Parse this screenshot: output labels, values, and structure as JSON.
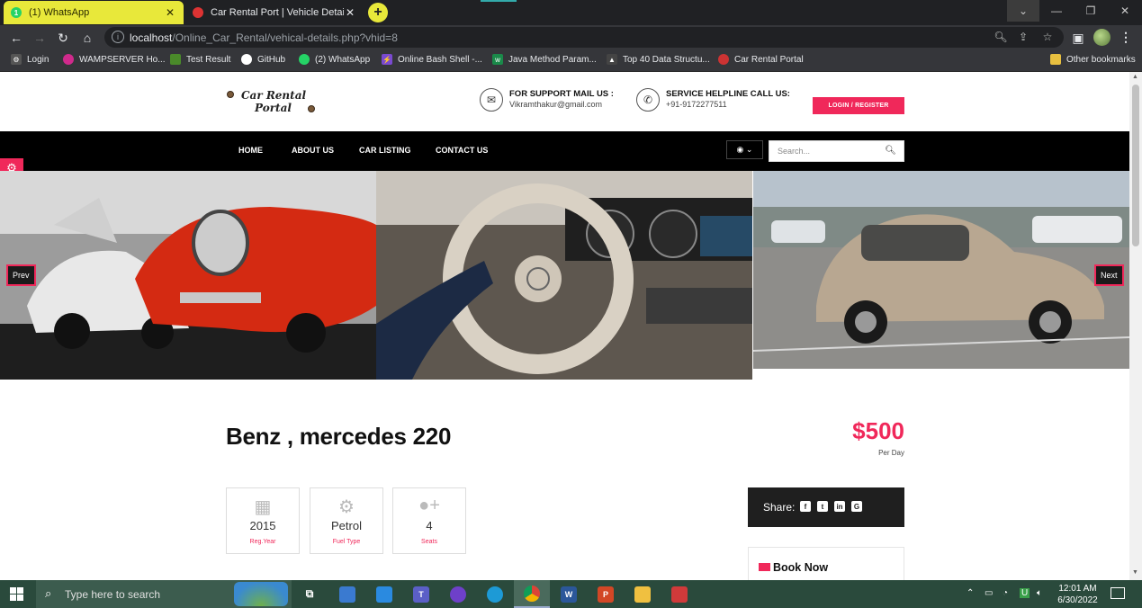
{
  "browser": {
    "tabs": [
      {
        "title": "(1) WhatsApp",
        "favicon": "whatsapp-icon",
        "badge": "1",
        "active": false
      },
      {
        "title": "Car Rental Port | Vehicle Details",
        "favicon": "car-icon",
        "active": true
      }
    ],
    "new_tab_symbol": "+",
    "url_host": "localhost",
    "url_path": "/Online_Car_Rental/vehical-details.php?vhid=8",
    "bookmarks": [
      {
        "label": "Login",
        "icon": "gear-icon"
      },
      {
        "label": "WAMPSERVER Ho...",
        "icon": "wamp-icon"
      },
      {
        "label": "Test Result",
        "icon": "leaf-icon"
      },
      {
        "label": "GitHub",
        "icon": "github-icon"
      },
      {
        "label": "(2) WhatsApp",
        "icon": "whatsapp-icon"
      },
      {
        "label": "Online Bash Shell -...",
        "icon": "bolt-icon"
      },
      {
        "label": "Java Method Param...",
        "icon": "w-icon"
      },
      {
        "label": "Top 40 Data Structu...",
        "icon": "mountain-icon"
      },
      {
        "label": "Car Rental Portal",
        "icon": "car-icon"
      }
    ],
    "other_bookmarks": "Other bookmarks"
  },
  "site": {
    "logo_line1": "Car Rental",
    "logo_line2": "Portal",
    "support_title": "FOR SUPPORT MAIL US :",
    "support_email": "Vikramthakur@gmail.com",
    "helpline_title": "SERVICE HELPLINE CALL US:",
    "helpline_phone": "+91-9172277511",
    "login_label": "LOGIN / REGISTER",
    "nav": [
      "HOME",
      "ABOUT US",
      "CAR LISTING",
      "CONTACT US"
    ],
    "search_placeholder": "Search...",
    "slider_prev": "Prev",
    "slider_next": "Next"
  },
  "vehicle": {
    "title": "Benz , mercedes 220",
    "price": "$500",
    "price_unit": "Per Day",
    "features": [
      {
        "value": "2015",
        "label": "Reg.Year",
        "icon": "calendar-icon"
      },
      {
        "value": "Petrol",
        "label": "Fuel Type",
        "icon": "cogs-icon"
      },
      {
        "value": "4",
        "label": "Seats",
        "icon": "user-plus-icon"
      }
    ],
    "share_label": "Share:",
    "book_label": "Book Now"
  },
  "taskbar": {
    "search_placeholder": "Type here to search",
    "time": "12:01 AM",
    "date": "6/30/2022"
  },
  "colors": {
    "accent": "#f0285a",
    "navbar": "#000000",
    "whatsapp_tab": "#e8e83a",
    "taskbar": "#2a4a3c"
  }
}
